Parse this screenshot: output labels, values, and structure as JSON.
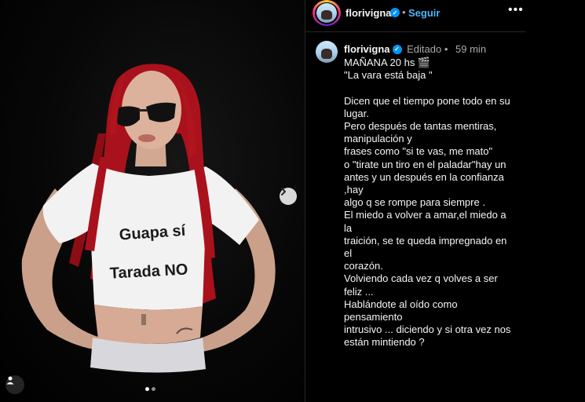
{
  "post": {
    "username": "florivigna",
    "follow_label": "Seguir",
    "separator": "•",
    "more_label": "•••",
    "media": {
      "shirt_text_line1": "Guapa sí",
      "shirt_text_line2": "Tarada NO",
      "carousel_total": 2,
      "carousel_active": 1
    },
    "caption": {
      "username": "florivigna",
      "edited_label": "Editado •",
      "time": "59 min",
      "lines": [
        "MAÑANA 20 hs 🎬",
        "\"La vara está baja \"",
        "",
        "Dicen que el tiempo pone todo en su",
        "lugar.",
        "Pero después de tantas mentiras,",
        "manipulación y",
        "frases como \"si te vas, me mato\"",
        "o \"tirate un tiro en el paladar\"hay un",
        "antes y un después en la confianza ,hay",
        "algo q se rompe para siempre .",
        "El miedo a volver a amar,el miedo a la",
        "traición, se te queda impregnado en el",
        "corazón.",
        "Volviendo cada vez q volves a ser feliz ...",
        "Hablándote al oído como pensamiento",
        "intrusivo ... diciendo y si otra vez nos",
        "están mintiendo ?"
      ]
    }
  },
  "colors": {
    "follow": "#4cb5f9",
    "verified": "#0095f6",
    "muted": "#a8a8a8",
    "hair": "#b0141c"
  },
  "icons": [
    "verified-badge-icon",
    "chevron-right-icon",
    "person-tag-icon",
    "more-icon"
  ]
}
